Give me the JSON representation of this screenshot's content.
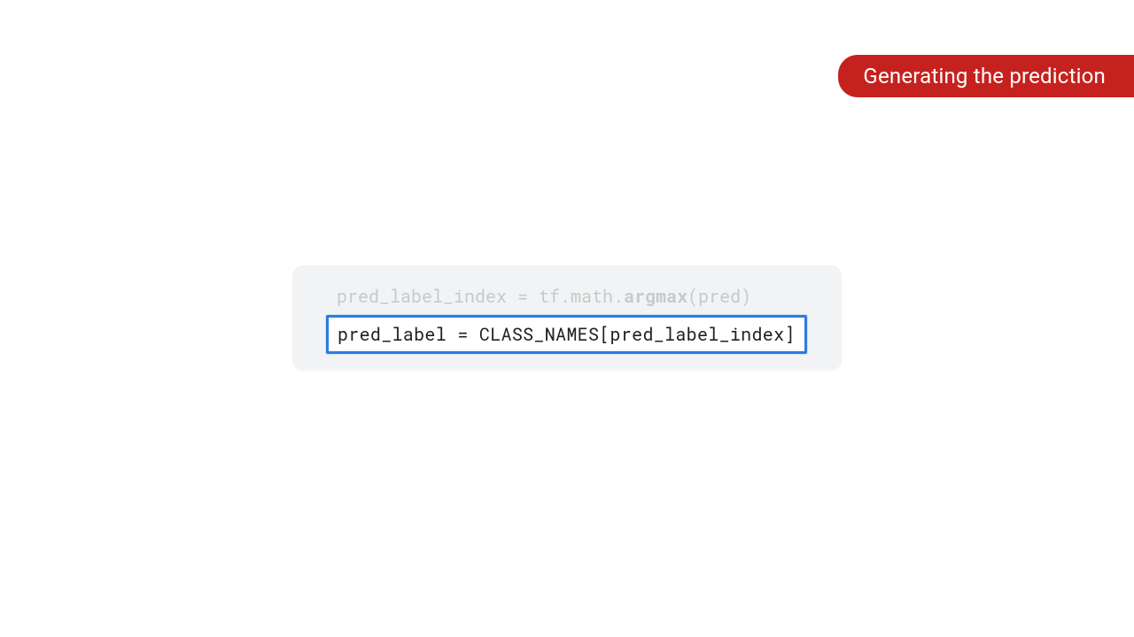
{
  "title_badge": "Generating the prediction",
  "code": {
    "faded_line_prefix": "pred_label_index = tf.math.",
    "faded_line_bold": "argmax",
    "faded_line_suffix": "(pred)",
    "highlighted_line": "pred_label = CLASS_NAMES[pred_label_index]"
  }
}
